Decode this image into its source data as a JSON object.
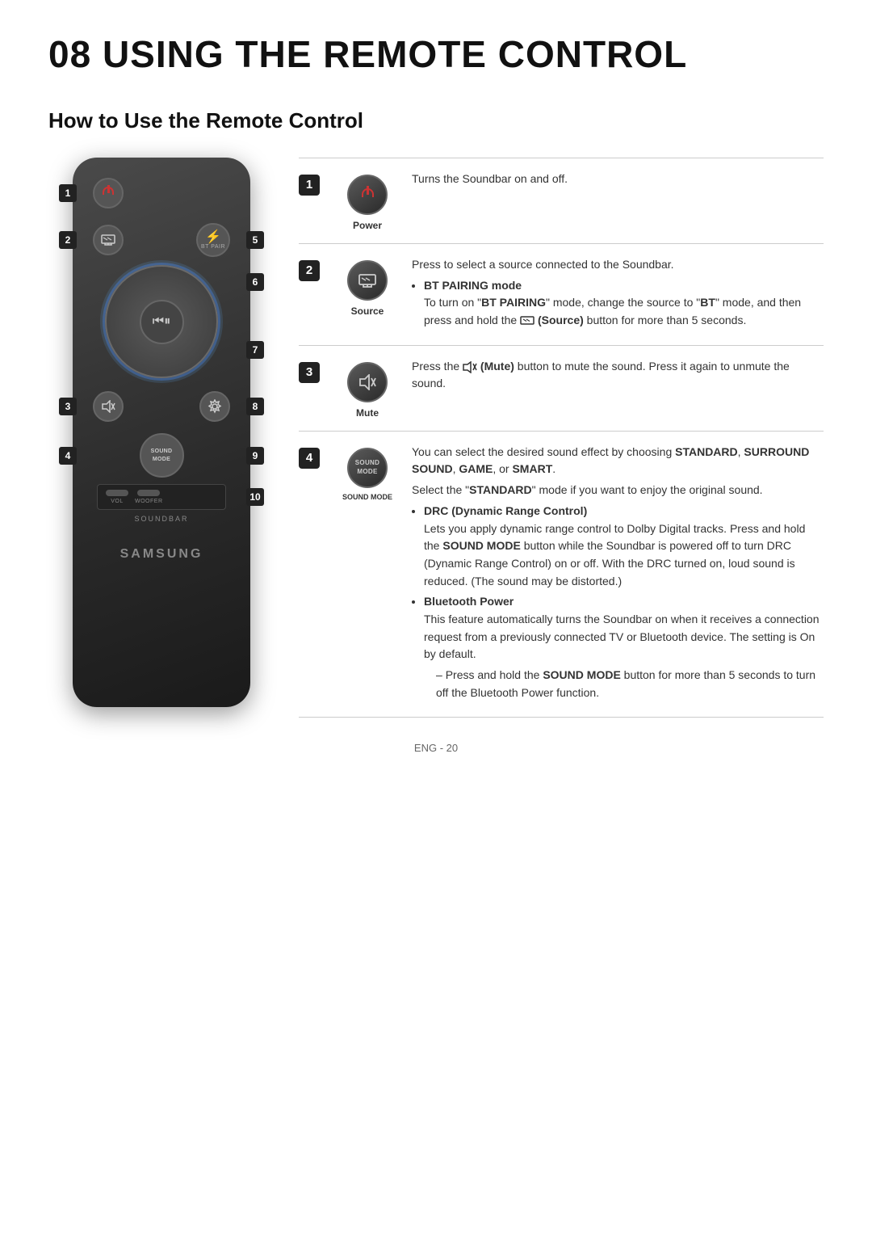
{
  "page": {
    "title": "08   USING THE REMOTE CONTROL",
    "subtitle": "How to Use the Remote Control",
    "footer": "ENG - 20"
  },
  "remote": {
    "labels": {
      "1": "1",
      "2": "2",
      "3": "3",
      "4": "4",
      "5": "5",
      "6": "6",
      "7": "7",
      "8": "8",
      "9": "9",
      "10": "10"
    },
    "buttons": {
      "power": "Power",
      "source": "Source",
      "bluetooth": "BT PAIR",
      "bt_symbol": "✦",
      "play_pause": "⏮⏸",
      "mute": "🔇",
      "settings": "⚙",
      "sound_mode_line1": "SOUND",
      "sound_mode_line2": "MODE"
    },
    "slider_labels": {
      "vol": "VOL",
      "woofer": "WOOFER"
    },
    "soundbar": "SOUNDBAR",
    "samsung": "SAMSUNG"
  },
  "descriptions": [
    {
      "num": "1",
      "button_label": "Power",
      "text_html": "Turns the Soundbar on and off."
    },
    {
      "num": "2",
      "button_label": "Source",
      "main": "Press to select a source connected to the Soundbar.",
      "bullet_title": "BT PAIRING mode",
      "bullet_body": "To turn on \"BT PAIRING\" mode, change the source to \"BT\" mode, and then press and hold the (Source) button for more than 5 seconds."
    },
    {
      "num": "3",
      "button_label": "Mute",
      "text": "Press the (Mute) button to mute the sound. Press it again to unmute the sound."
    },
    {
      "num": "4",
      "button_label": "SOUND MODE",
      "main": "You can select the desired sound effect by choosing STANDARD, SURROUND SOUND, GAME, or SMART.",
      "secondary": "Select the \"STANDARD\" mode if you want to enjoy the original sound.",
      "bullets": [
        {
          "title": "DRC (Dynamic Range Control)",
          "body": "Lets you apply dynamic range control to Dolby Digital tracks. Press and hold the SOUND MODE button while the Soundbar is powered off to turn DRC (Dynamic Range Control) on or off. With the DRC turned on, loud sound is reduced. (The sound may be distorted.)"
        },
        {
          "title": "Bluetooth Power",
          "body": "This feature automatically turns the Soundbar on when it receives a connection request from a previously connected TV or Bluetooth device. The setting is On by default.",
          "dash": "Press and hold the SOUND MODE button for more than 5 seconds to turn off the Bluetooth Power function."
        }
      ]
    }
  ]
}
